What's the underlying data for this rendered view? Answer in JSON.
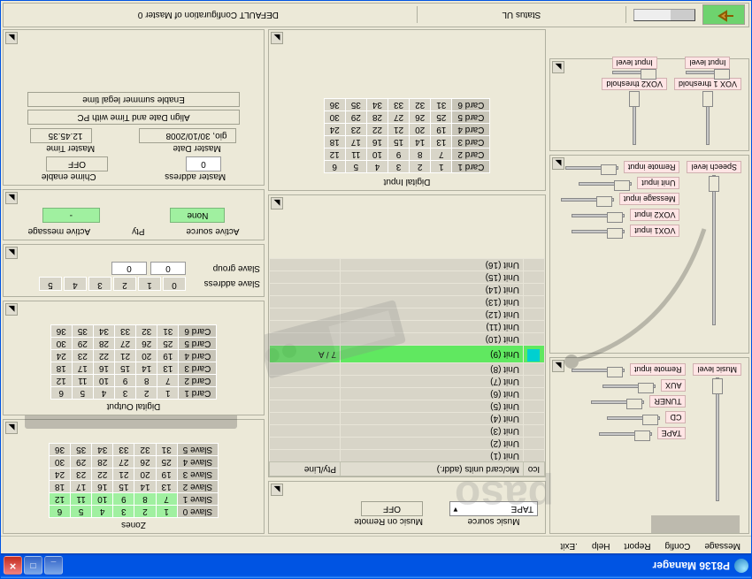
{
  "window_title": "P8136 Manager",
  "menubar": [
    "Message",
    "Config",
    "Report",
    "Help",
    ".Exit"
  ],
  "topbar": {
    "status_ul": "Status UL",
    "config_label": "DEFAULT Configuration of Master 0"
  },
  "left": {
    "vox1": "VOX 1 threshold",
    "vox2": "VOX2 threshold",
    "input_level1": "Input level",
    "input_level2": "Input level",
    "music_level": "Music level",
    "speech_level": "Speech level",
    "sources": [
      "TAPE",
      "CD",
      "TUNER",
      "AUX",
      "Remote input"
    ],
    "inputs": [
      "VOX1 input",
      "VOX2 input",
      "Message input",
      "Unit input",
      "Remote input"
    ]
  },
  "mid": {
    "music_source_label": "Music source",
    "music_source_value": "TAPE",
    "music_remote_label": "Music on Remote",
    "music_remote_value": "OFF",
    "list_headers": [
      "Ico",
      "Mic/card units (addr.)",
      "Pty/Line"
    ],
    "units": [
      {
        "label": "Unit (1)"
      },
      {
        "label": "Unit (2)"
      },
      {
        "label": "Unit (3)"
      },
      {
        "label": "Unit (4)"
      },
      {
        "label": "Unit (5)"
      },
      {
        "label": "Unit (6)"
      },
      {
        "label": "Unit (7)"
      },
      {
        "label": "Unit (8)"
      },
      {
        "label": "Unit (9)",
        "pty": "7 / A",
        "selected": true
      },
      {
        "label": "Unit (10)"
      },
      {
        "label": "Unit (11)"
      },
      {
        "label": "Unit (12)"
      },
      {
        "label": "Unit (13)"
      },
      {
        "label": "Unit (14)"
      },
      {
        "label": "Unit (15)"
      },
      {
        "label": "Unit (16)"
      }
    ],
    "digital_input_label": "Digital Input",
    "card_rows": [
      "Card 1",
      "Card 2",
      "Card 3",
      "Card 4",
      "Card 5",
      "Card 6"
    ],
    "card_grid": [
      [
        1,
        2,
        3,
        4,
        5,
        6
      ],
      [
        7,
        8,
        9,
        10,
        11,
        12
      ],
      [
        13,
        14,
        15,
        16,
        17,
        18
      ],
      [
        19,
        20,
        21,
        22,
        23,
        24
      ],
      [
        25,
        26,
        27,
        28,
        29,
        30
      ],
      [
        31,
        32,
        33,
        34,
        35,
        36
      ]
    ]
  },
  "right": {
    "zones_label": "Zones",
    "slave_rows": [
      "Slave 0",
      "Slave 1",
      "Slave 2",
      "Slave 3",
      "Slave 4",
      "Slave 5"
    ],
    "zones_grid": [
      [
        1,
        2,
        3,
        4,
        5,
        6
      ],
      [
        7,
        8,
        9,
        10,
        11,
        12
      ],
      [
        13,
        14,
        15,
        16,
        17,
        18
      ],
      [
        19,
        20,
        21,
        22,
        23,
        24
      ],
      [
        25,
        26,
        27,
        28,
        29,
        30
      ],
      [
        31,
        32,
        33,
        34,
        35,
        36
      ]
    ],
    "digital_output_label": "Digital Output",
    "out_rows": [
      "Card 1",
      "Card 2",
      "Card 3",
      "Card 4",
      "Card 5",
      "Card 6"
    ],
    "out_grid": [
      [
        1,
        2,
        3,
        4,
        5,
        6
      ],
      [
        7,
        8,
        9,
        10,
        11,
        12
      ],
      [
        13,
        14,
        15,
        16,
        17,
        18
      ],
      [
        19,
        20,
        21,
        22,
        23,
        24
      ],
      [
        25,
        26,
        27,
        28,
        29,
        30
      ],
      [
        31,
        32,
        33,
        34,
        35,
        36
      ]
    ],
    "slave_address_label": "Slave address",
    "slave_addresses": [
      0,
      1,
      2,
      3,
      4,
      5
    ],
    "slave_group_label": "Slave group",
    "slave_group": [
      "0",
      "0"
    ],
    "active_source_label": "Active source",
    "pty_label": "Pty",
    "active_message_label": "Active message",
    "active_source_value": "None",
    "active_message_value": "-",
    "master_address_label": "Master address",
    "chime_label": "Chime enable",
    "master_address_value": "0",
    "chime_value": "OFF",
    "master_date_label": "Master Date",
    "master_time_label": "Master Time",
    "master_date_value": "gio, 30/10/2008",
    "master_time_value": "12.45.35",
    "align_btn": "Align Date and Time with PC",
    "summer_btn": "Enable summer legal time"
  }
}
